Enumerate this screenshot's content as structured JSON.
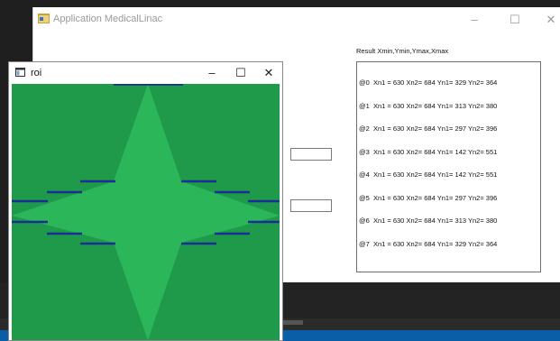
{
  "main_window": {
    "title": "Application MedicalLinac",
    "minimize": "–",
    "maximize": "☐",
    "close": "✕",
    "result_label": "Result Xmin,Ymin,Ymax,Xmax",
    "result_lines": [
      "@0  Xn1 = 630 Xn2= 684 Yn1= 329 Yn2= 364",
      "@1  Xn1 = 630 Xn2= 684 Yn1= 313 Yn2= 380",
      "@2  Xn1 = 630 Xn2= 684 Yn1= 297 Yn2= 396",
      "@3  Xn1 = 630 Xn2= 684 Yn1= 142 Yn2= 551",
      "@4  Xn1 = 630 Xn2= 684 Yn1= 142 Yn2= 551",
      "@5  Xn1 = 630 Xn2= 684 Yn1= 297 Yn2= 396",
      "@6  Xn1 = 630 Xn2= 684 Yn1= 313 Yn2= 380",
      "@7  Xn1 = 630 Xn2= 684 Yn1= 329 Yn2= 364"
    ],
    "field1_value": "",
    "field2_value": ""
  },
  "roi_window": {
    "title": "roi",
    "minimize": "–",
    "maximize": "☐",
    "close": "✕"
  },
  "colors": {
    "roi_background": "#1f9a4a",
    "star_fill": "#2bb65a",
    "segment": "#1b2e96"
  },
  "icons": {
    "app": "app-window-icon",
    "roi": "window-icon"
  }
}
